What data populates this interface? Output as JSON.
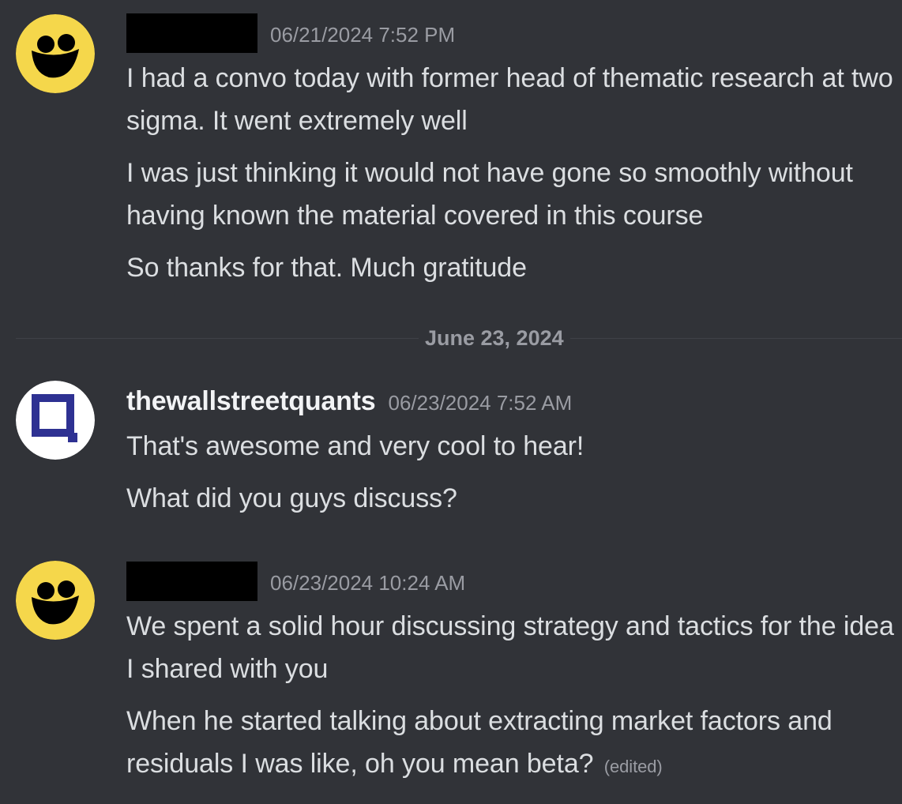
{
  "messages": [
    {
      "author": "",
      "timestamp": "06/21/2024 7:52 PM",
      "lines": [
        "I had a convo today with former head of thematic research at two sigma. It went extremely well",
        "I was just thinking it would not have gone so smoothly without having known the material covered in this course",
        "So thanks for that. Much gratitude"
      ]
    },
    {
      "author": "thewallstreetquants",
      "timestamp": "06/23/2024 7:52 AM",
      "lines": [
        "That's awesome and very cool to hear!",
        "What did you guys discuss?"
      ]
    },
    {
      "author": "",
      "timestamp": "06/23/2024 10:24 AM",
      "lines": [
        "We spent a solid hour discussing strategy and tactics for the idea I shared with you",
        "When he started talking about extracting market factors and residuals I was like, oh you mean beta?"
      ],
      "edited_label": "(edited)"
    }
  ],
  "date_divider": "June 23, 2024",
  "icons": {
    "user_avatar": "yellow-face-avatar",
    "quants_avatar": "blue-square-logo-avatar"
  },
  "colors": {
    "background": "#313338",
    "avatar_yellow": "#f5d74b",
    "brand_blue": "#2e3192"
  }
}
